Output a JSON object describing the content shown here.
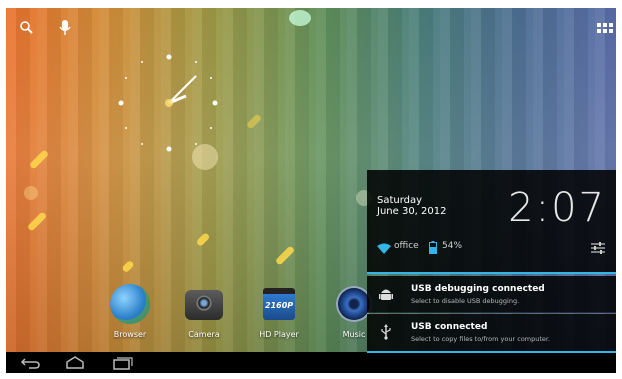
{
  "home": {
    "apps": [
      {
        "label": "Browser",
        "icon": "globe-icon"
      },
      {
        "label": "Camera",
        "icon": "camera-icon"
      },
      {
        "label": "HD Player",
        "icon": "clapperboard-icon"
      },
      {
        "label": "Music",
        "icon": "music-icon"
      }
    ],
    "hd_player_badge": "2160P"
  },
  "quick_settings": {
    "day": "Saturday",
    "date": "June 30, 2012",
    "time": "2:07",
    "wifi_label": "office",
    "battery_label": "54%"
  },
  "notifications": [
    {
      "title": "USB debugging connected",
      "text": "Select to disable USB debugging.",
      "icon": "android-debug-icon"
    },
    {
      "title": "USB connected",
      "text": "Select to copy files to/from your computer.",
      "icon": "usb-icon"
    }
  ],
  "colors": {
    "accent": "#33b5e5",
    "navbar": "#000000",
    "panel": "#000000"
  }
}
